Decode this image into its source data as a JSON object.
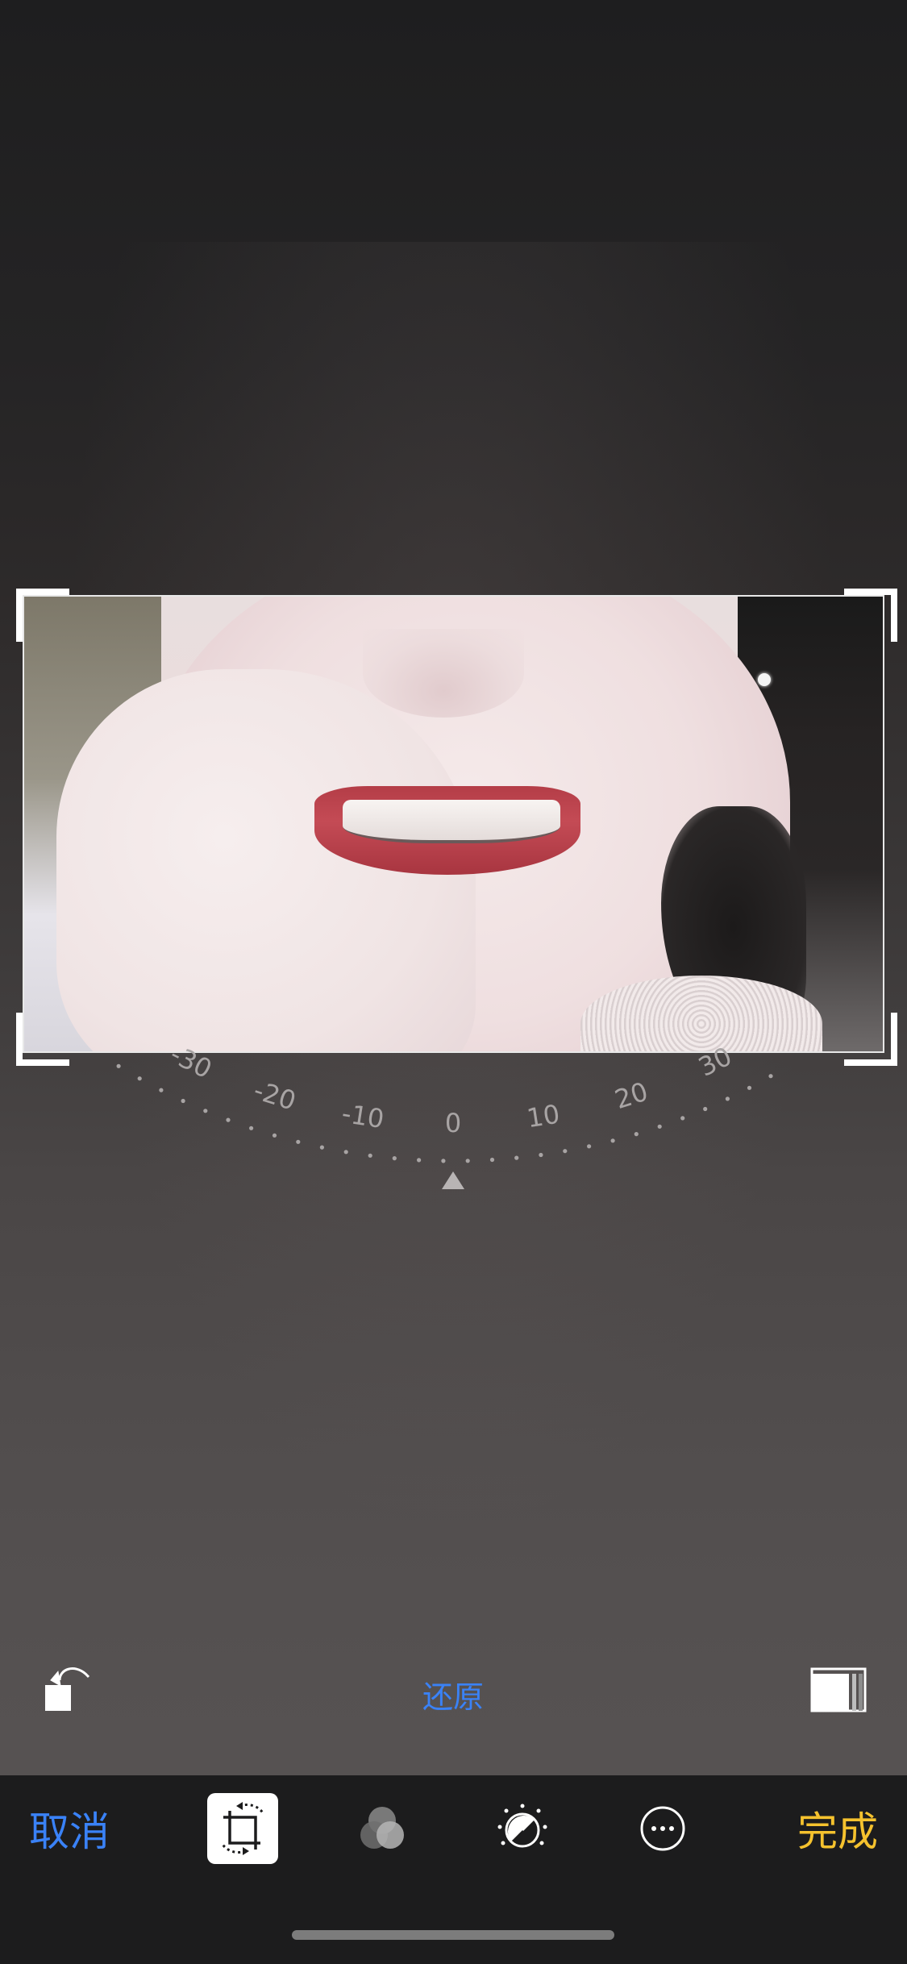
{
  "editor": {
    "reset_label": "还原"
  },
  "angle_dial": {
    "ticks": [
      "-30",
      "-20",
      "-10",
      "0",
      "10",
      "20",
      "30"
    ],
    "current_value": 0
  },
  "toolbar": {
    "cancel_label": "取消",
    "done_label": "完成",
    "active_tool": "crop",
    "tools": [
      "crop-rotate-icon",
      "filters-icon",
      "adjust-icon",
      "more-icon"
    ]
  },
  "colors": {
    "accent_blue": "#3a82f7",
    "done_yellow": "#f5c22e",
    "toolbar_bg": "#1c1c1d"
  }
}
